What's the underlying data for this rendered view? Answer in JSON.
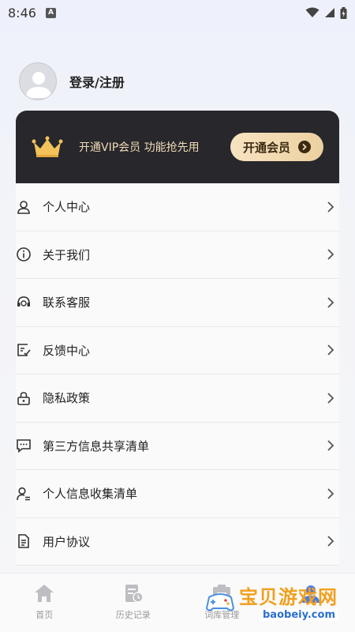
{
  "status_bar": {
    "time": "8:46",
    "notification_letter": "A"
  },
  "profile": {
    "login_label": "登录/注册"
  },
  "vip": {
    "promo_text": "开通VIP会员 功能抢先用",
    "button_label": "开通会员"
  },
  "menu": {
    "items": [
      {
        "label": "个人中心",
        "icon": "user-icon"
      },
      {
        "label": "关于我们",
        "icon": "info-icon"
      },
      {
        "label": "联系客服",
        "icon": "headset-icon"
      },
      {
        "label": "反馈中心",
        "icon": "feedback-icon"
      },
      {
        "label": "隐私政策",
        "icon": "lock-icon"
      },
      {
        "label": "第三方信息共享清单",
        "icon": "message-icon"
      },
      {
        "label": "个人信息收集清单",
        "icon": "user-list-icon"
      },
      {
        "label": "用户协议",
        "icon": "document-icon"
      }
    ]
  },
  "tabbar": {
    "tabs": [
      {
        "label": "首页",
        "icon": "home-icon"
      },
      {
        "label": "历史记录",
        "icon": "history-icon"
      },
      {
        "label": "词库管理",
        "icon": "library-icon"
      },
      {
        "label": "我的",
        "icon": "profile-icon",
        "active": true
      }
    ]
  },
  "watermark": {
    "text": "宝贝游戏网",
    "url": "baobeiy.com"
  }
}
